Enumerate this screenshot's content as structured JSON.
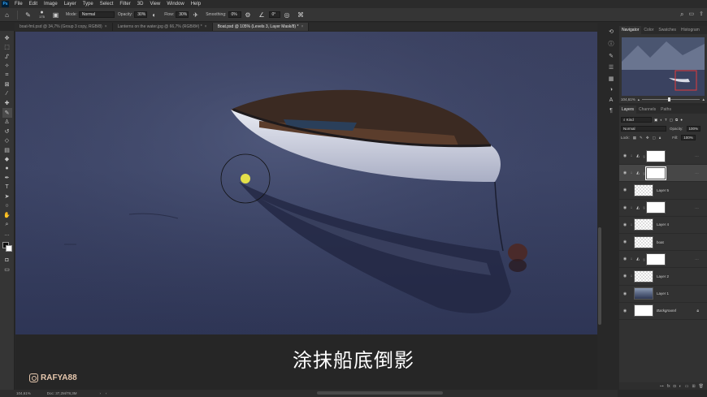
{
  "menu": [
    "File",
    "Edit",
    "Image",
    "Layer",
    "Type",
    "Select",
    "Filter",
    "3D",
    "View",
    "Window",
    "Help"
  ],
  "options": {
    "brush_size": "175",
    "mode_label": "Mode:",
    "mode_value": "Normal",
    "opacity_label": "Opacity:",
    "opacity_value": "30%",
    "flow_label": "Flow:",
    "flow_value": "30%",
    "smoothing_label": "Smoothing:",
    "smoothing_value": "0%",
    "angle_value": "0°"
  },
  "tabs": [
    {
      "label": "boat-fml.psd @ 34,7% (Group 3 copy, RGB/8)",
      "active": false
    },
    {
      "label": "Lanterns on the water.jpg @ 66,7% (RGB/8#) *",
      "active": false
    },
    {
      "label": "Boat.psd @ 105% (Levels 3, Layer Mask/8) *",
      "active": true
    }
  ],
  "subtitle": "涂抹船底倒影",
  "watermark": "RAFYA88",
  "navigator": {
    "tabs": [
      "Navigator",
      "Color",
      "Swatches",
      "Histogram"
    ],
    "zoom": "104,61%"
  },
  "layers_panel": {
    "tabs": [
      "Layers",
      "Channels",
      "Paths"
    ],
    "filter_kind": "Kind",
    "blend_mode": "Normal",
    "opacity_label": "Opacity:",
    "opacity_value": "100%",
    "lock_label": "Lock:",
    "fill_label": "Fill:",
    "fill_value": "100%",
    "layers": [
      {
        "name": "",
        "kind": "adjustment",
        "icon": "levels-icon",
        "thumb": "white",
        "clipped": true,
        "selected": false
      },
      {
        "name": "",
        "kind": "adjustment",
        "icon": "levels-icon",
        "thumb": "white",
        "clipped": true,
        "selected": true
      },
      {
        "name": "Layer 5",
        "kind": "pixel",
        "thumb": "check",
        "clipped": false,
        "selected": false
      },
      {
        "name": "",
        "kind": "adjustment",
        "icon": "levels-icon",
        "thumb": "white",
        "clipped": true,
        "selected": false
      },
      {
        "name": "Layer 4",
        "kind": "pixel",
        "thumb": "check",
        "clipped": true,
        "selected": false
      },
      {
        "name": "boat",
        "kind": "pixel",
        "thumb": "check",
        "clipped": false,
        "selected": false
      },
      {
        "name": "",
        "kind": "adjustment",
        "icon": "levels-icon",
        "thumb": "white",
        "clipped": true,
        "selected": false
      },
      {
        "name": "Layer 2",
        "kind": "pixel",
        "thumb": "check",
        "clipped": true,
        "selected": false
      },
      {
        "name": "Layer 1",
        "kind": "pixel",
        "thumb": "photo",
        "clipped": false,
        "selected": false
      },
      {
        "name": "Background",
        "kind": "background",
        "thumb": "white",
        "clipped": false,
        "selected": false,
        "locked": true
      }
    ]
  },
  "status": {
    "zoom": "104,61%",
    "doc": "Doc: 37,2M/78,3M"
  }
}
